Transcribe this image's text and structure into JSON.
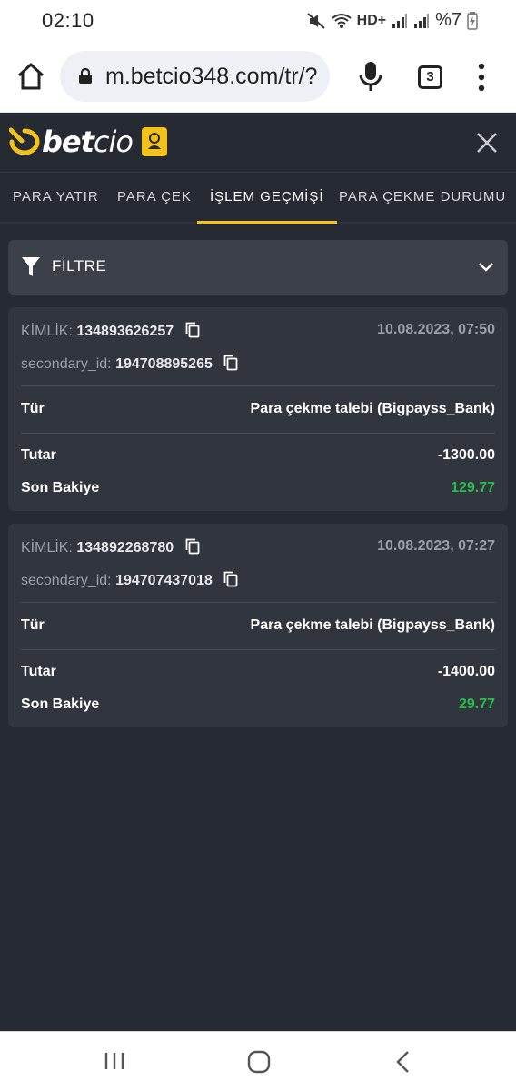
{
  "status_bar": {
    "time": "02:10",
    "network_label": "HD+",
    "battery_text": "%7",
    "icons": [
      "mute-icon",
      "wifi-icon",
      "signal-icon",
      "signal-icon",
      "battery-icon"
    ]
  },
  "browser": {
    "url": "m.betcio348.com/tr/?",
    "tab_count": "3",
    "icons": [
      "home-icon",
      "lock-icon",
      "mic-icon",
      "more-vert-icon"
    ]
  },
  "app": {
    "brand": {
      "bold": "bet",
      "light": "cio"
    },
    "brand_color": "#f2c21b"
  },
  "tabs": [
    {
      "label": "PARA YATIR"
    },
    {
      "label": "PARA ÇEK"
    },
    {
      "label": "İŞLEM GEÇMİŞİ",
      "active": true
    },
    {
      "label": "PARA ÇEKME DURUMU"
    }
  ],
  "filter": {
    "label": "FİLTRE"
  },
  "transactions": [
    {
      "id_label": "KİMLİK:",
      "id": "134893626257",
      "date": "10.08.2023, 07:50",
      "secondary_label": "secondary_id:",
      "secondary_id": "194708895265",
      "type_label": "Tür",
      "type": "Para çekme talebi (Bigpayss_Bank)",
      "amount_label": "Tutar",
      "amount": "-1300.00",
      "balance_label": "Son Bakiye",
      "balance": "129.77"
    },
    {
      "id_label": "KİMLİK:",
      "id": "134892268780",
      "date": "10.08.2023, 07:27",
      "secondary_label": "secondary_id:",
      "secondary_id": "194707437018",
      "type_label": "Tür",
      "type": "Para çekme talebi (Bigpayss_Bank)",
      "amount_label": "Tutar",
      "amount": "-1400.00",
      "balance_label": "Son Bakiye",
      "balance": "29.77"
    }
  ],
  "colors": {
    "background": "#262a33",
    "card": "#30353e",
    "accent": "#f2c21b",
    "positive": "#2bbd49"
  }
}
